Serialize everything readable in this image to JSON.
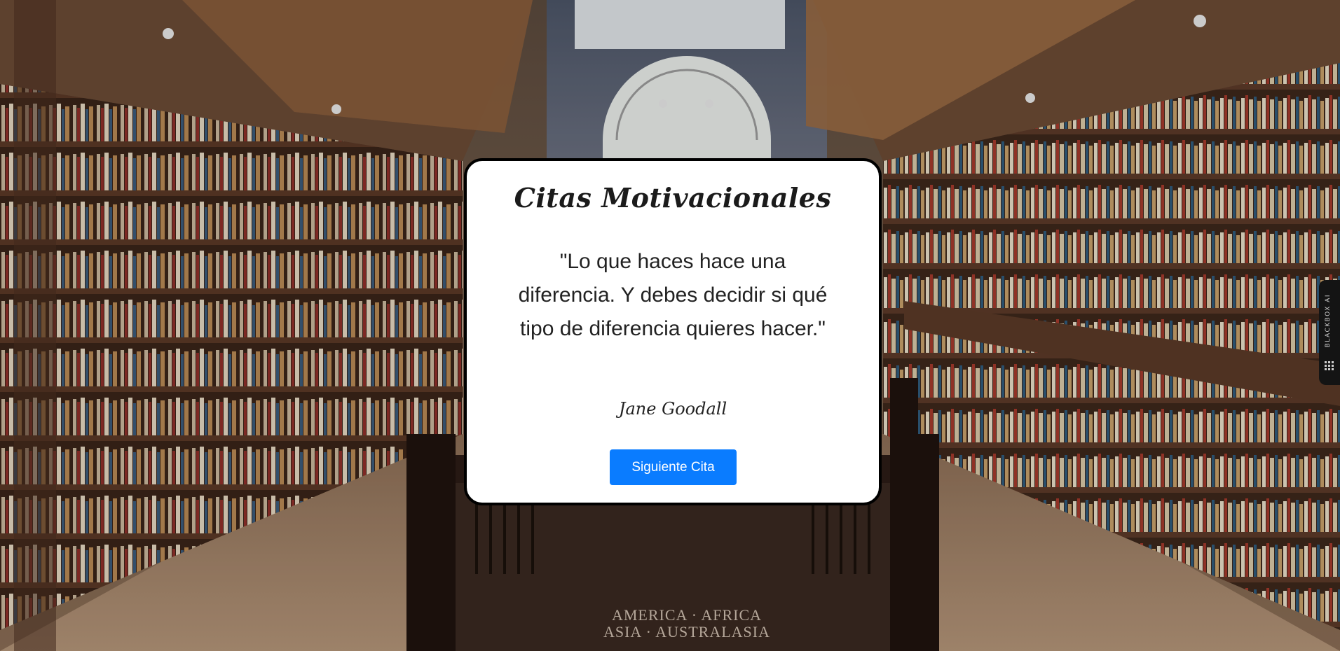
{
  "app": {
    "title": "Citas Motivacionales"
  },
  "quote": {
    "text": "\"Lo que haces hace una diferencia. Y debes decidir si qué tipo de diferencia quieres hacer.\"",
    "author": "Jane Goodall"
  },
  "actions": {
    "next_label": "Siguiente Cita"
  },
  "side_tab": {
    "label": "BLACKBOX AI",
    "icon": "blackbox-logo-icon"
  },
  "background": {
    "floor_sign_line1": "AMERICA · AFRICA",
    "floor_sign_line2": "ASIA · AUSTRALASIA"
  },
  "colors": {
    "button": "#0a7cff",
    "card_border": "#000000",
    "card_background": "#ffffff"
  }
}
